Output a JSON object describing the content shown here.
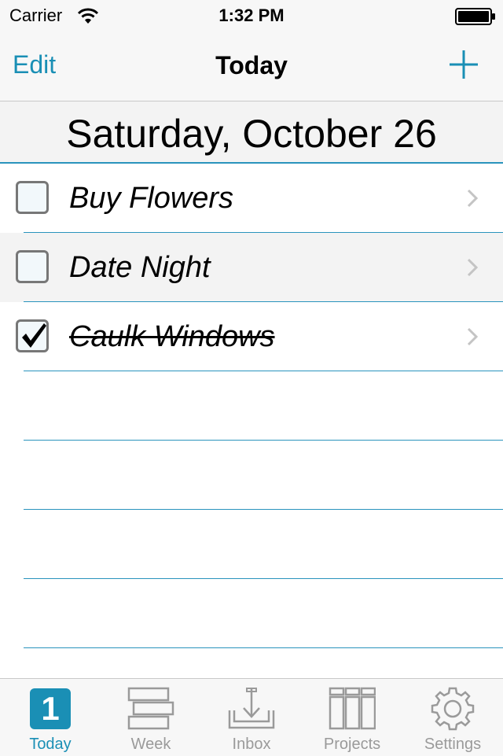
{
  "status_bar": {
    "carrier": "Carrier",
    "time": "1:32 PM",
    "wifi_icon": "wifi-icon",
    "battery_icon": "battery-icon"
  },
  "nav": {
    "edit_label": "Edit",
    "title": "Today",
    "add_icon": "plus-icon"
  },
  "date_header": "Saturday, October 26",
  "tasks": [
    {
      "label": "Buy Flowers",
      "checked": false
    },
    {
      "label": "Date Night",
      "checked": false
    },
    {
      "label": "Caulk Windows",
      "checked": true
    }
  ],
  "tabs": [
    {
      "label": "Today",
      "badge": "1",
      "active": true
    },
    {
      "label": "Week",
      "icon": "week-icon",
      "active": false
    },
    {
      "label": "Inbox",
      "icon": "inbox-icon",
      "active": false
    },
    {
      "label": "Projects",
      "icon": "projects-icon",
      "active": false
    },
    {
      "label": "Settings",
      "icon": "gear-icon",
      "active": false
    }
  ],
  "colors": {
    "accent": "#1a8fb5",
    "separator": "#2a94bd",
    "inactive": "#9a9a9a"
  }
}
